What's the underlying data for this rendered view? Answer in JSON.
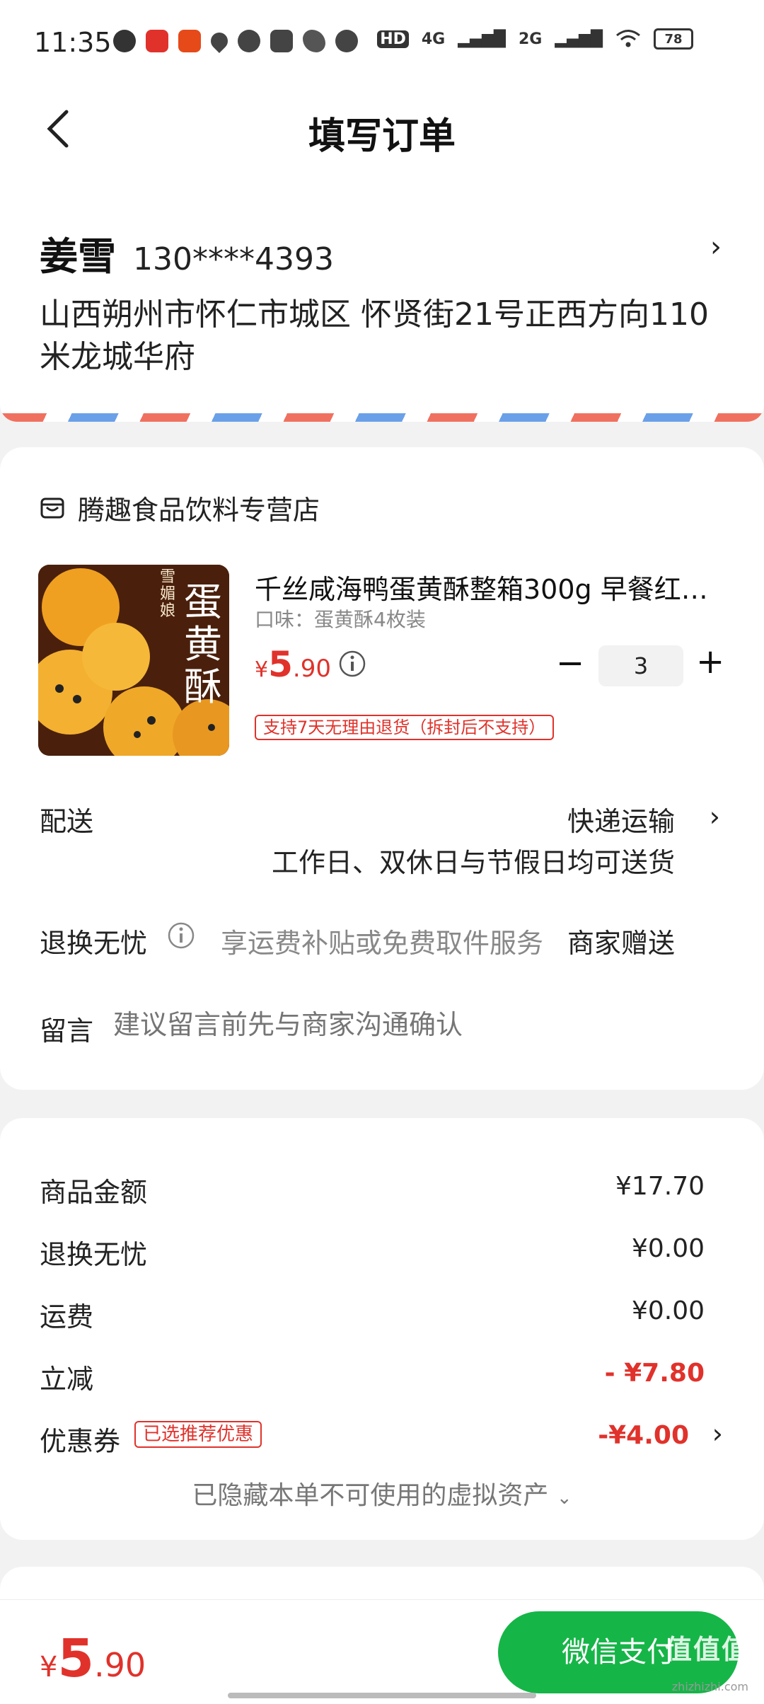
{
  "status_bar": {
    "time": "11:35",
    "network_1": "4G",
    "network_2": "2G",
    "battery": "78",
    "hd": "HD"
  },
  "nav": {
    "title": "填写订单"
  },
  "address": {
    "name": "姜雪",
    "phone": "130****4393",
    "detail": "山西朔州市怀仁市城区 怀贤街21号正西方向110米龙城华府"
  },
  "shop": {
    "name": "腾趣食品饮料专营店"
  },
  "product": {
    "title": "千丝咸海鸭蛋黄酥整箱300g 早餐红…",
    "spec": "口味：蛋黄酥4枚装",
    "price_symbol": "¥",
    "price_int": "5",
    "price_dec": ".90",
    "quantity": "3",
    "return_tag": "支持7天无理由退货（拆封后不支持）",
    "image_text_1": "蛋",
    "image_text_2": "黄",
    "image_text_3": "酥",
    "image_brand": "雪媚娘"
  },
  "delivery": {
    "label": "配送",
    "value": "快递运输",
    "sub": "工作日、双休日与节假日均可送货"
  },
  "worry_free": {
    "label": "退换无忧",
    "desc": "享运费补贴或免费取件服务",
    "value": "商家赠送"
  },
  "message": {
    "label": "留言",
    "placeholder": "建议留言前先与商家沟通确认"
  },
  "summary": {
    "goods_label": "商品金额",
    "goods_value": "¥17.70",
    "worry_label": "退换无忧",
    "worry_value": "¥0.00",
    "shipping_label": "运费",
    "shipping_value": "¥0.00",
    "discount_label": "立减",
    "discount_value": "- ¥7.80",
    "coupon_label": "优惠券",
    "coupon_tag": "已选推荐优惠",
    "coupon_value": "-¥4.00",
    "hidden_assets": "已隐藏本单不可使用的虚拟资产"
  },
  "footer": {
    "total_symbol": "¥",
    "total_int": "5",
    "total_dec": ".90",
    "pay_button": "微信支付",
    "watermark": "值值值",
    "watermark_sub": "zhizhizhi.com"
  },
  "colors": {
    "accent_red": "#e0322b",
    "pay_green": "#16b548"
  }
}
